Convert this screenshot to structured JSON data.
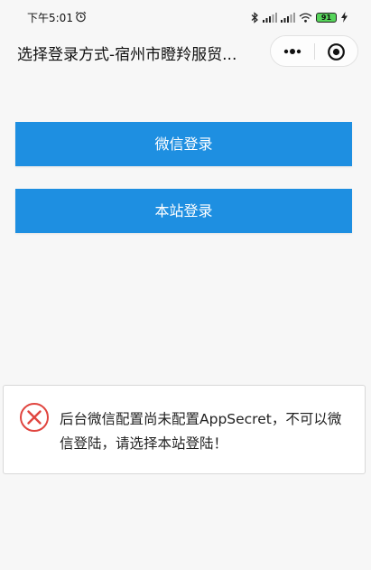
{
  "status_bar": {
    "time": "下午5:01",
    "battery": "91"
  },
  "nav": {
    "title": "选择登录方式-宿州市瞪羚服贸..."
  },
  "buttons": {
    "wechat_login": "微信登录",
    "site_login": "本站登录"
  },
  "notice": {
    "message": "后台微信配置尚未配置AppSecret，不可以微信登陆，请选择本站登陆！",
    "icon": "error-circle-icon"
  },
  "colors": {
    "primary": "#1e8fe1",
    "error": "#e0453f",
    "background": "#f7f7f7"
  }
}
